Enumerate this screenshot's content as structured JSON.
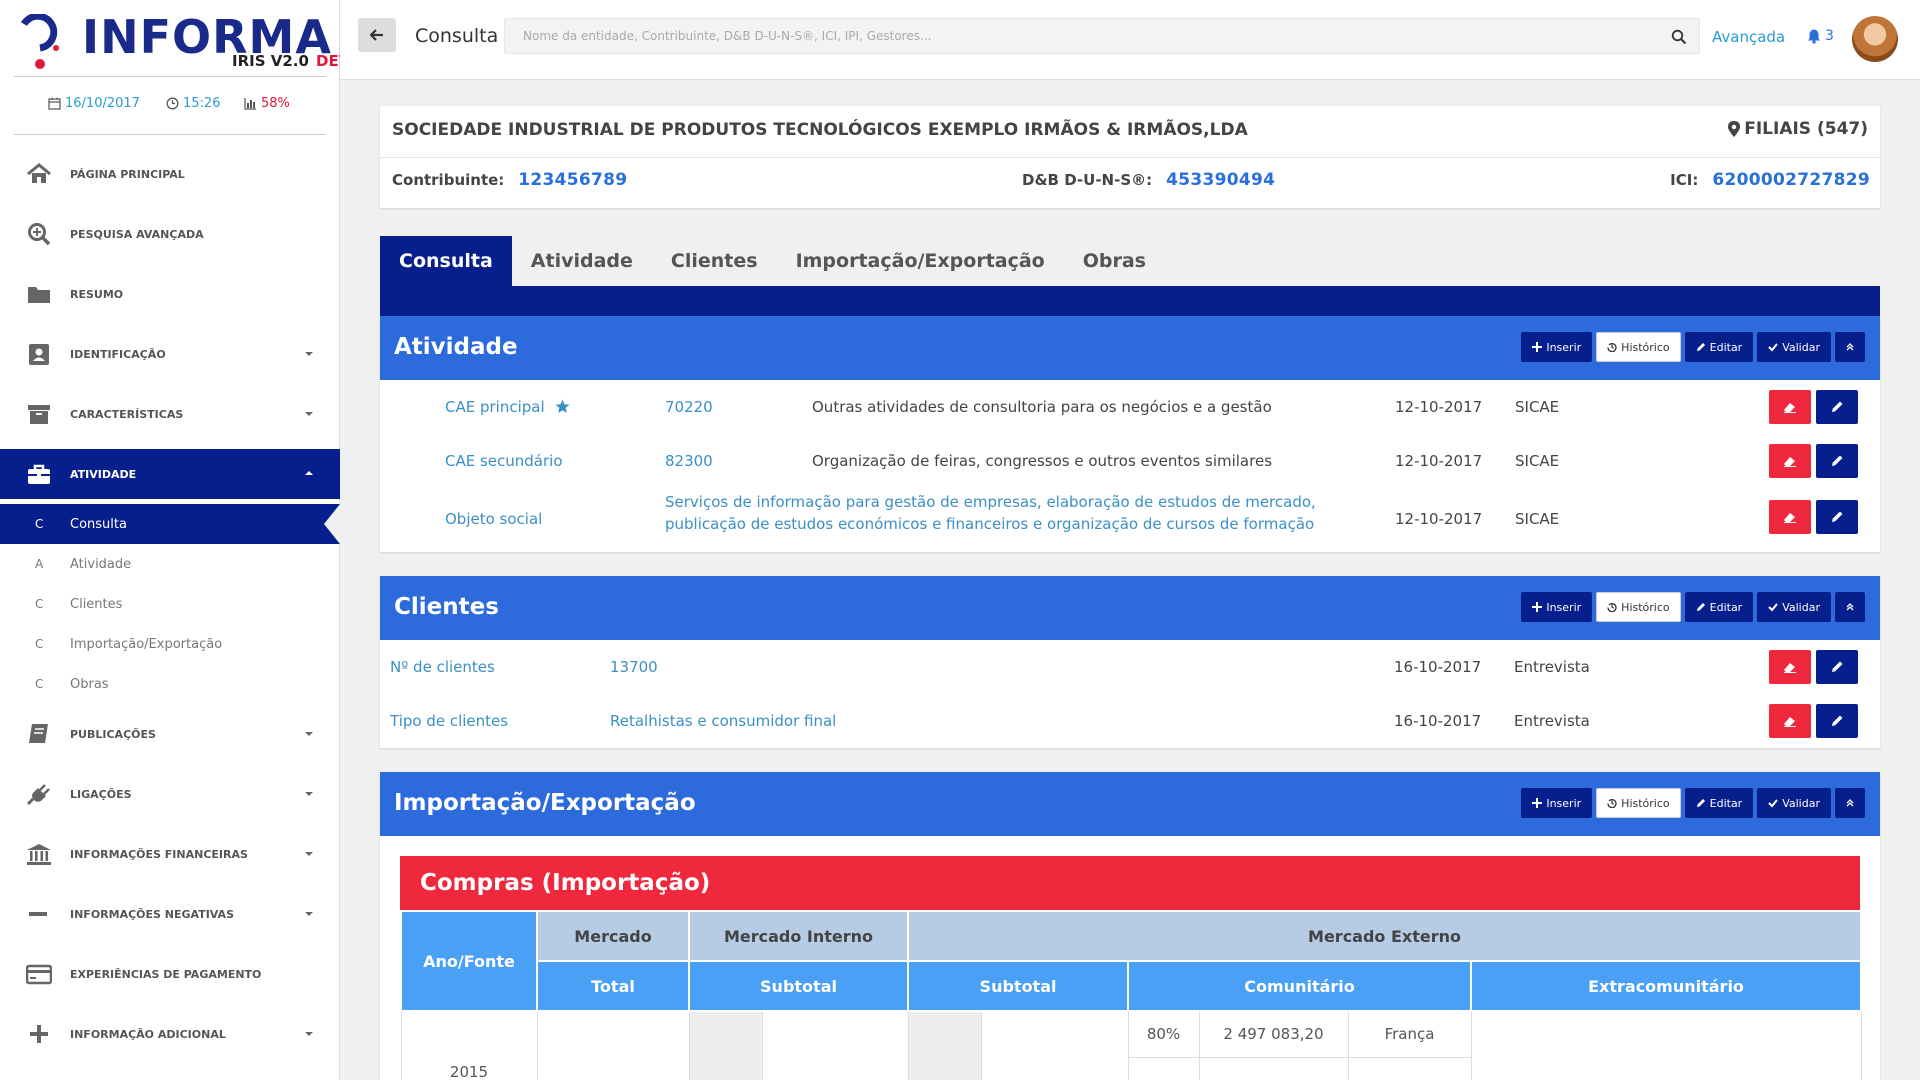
{
  "brand": {
    "name": "INFORMA",
    "version": "IRIS V2.0",
    "env": "DEV"
  },
  "status": {
    "date": "16/10/2017",
    "time": "15:26",
    "percent": "58%"
  },
  "nav": {
    "items": [
      {
        "label": "PÁGINA PRINCIPAL",
        "icon": "home-icon"
      },
      {
        "label": "PESQUISA AVANÇADA",
        "icon": "zoom-icon"
      },
      {
        "label": "RESUMO",
        "icon": "folder-icon"
      },
      {
        "label": "IDENTIFICAÇÃO",
        "icon": "id-card-icon"
      },
      {
        "label": "CARACTERÍSTICAS",
        "icon": "archive-icon"
      },
      {
        "label": "ATIVIDADE",
        "icon": "briefcase-icon"
      },
      {
        "label": "PUBLICAÇÕES",
        "icon": "book-icon"
      },
      {
        "label": "LIGAÇÕES",
        "icon": "plug-icon"
      },
      {
        "label": "INFORMAÇÕES FINANCEIRAS",
        "icon": "bank-icon"
      },
      {
        "label": "INFORMAÇÕES NEGATIVAS",
        "icon": "minus-icon"
      },
      {
        "label": "EXPERIÊNCIAS DE PAGAMENTO",
        "icon": "credit-card-icon"
      },
      {
        "label": "INFORMAÇÃO ADICIONAL",
        "icon": "plus-icon"
      }
    ],
    "sub": [
      {
        "letter": "C",
        "label": "Consulta"
      },
      {
        "letter": "A",
        "label": "Atividade"
      },
      {
        "letter": "C",
        "label": "Clientes"
      },
      {
        "letter": "C",
        "label": "Importação/Exportação"
      },
      {
        "letter": "C",
        "label": "Obras"
      }
    ]
  },
  "topbar": {
    "title": "Consulta",
    "search_placeholder": "Nome da entidade, Contribuinte, D&B D-U-N-S®, ICI, IPI, Gestores...",
    "advanced": "Avançada",
    "notifications": "3"
  },
  "entity": {
    "name": "SOCIEDADE INDUSTRIAL DE PRODUTOS TECNOLÓGICOS EXEMPLO IRMÃOS & IRMÃOS,LDA",
    "filiais": "FILIAIS (547)",
    "contribuinte_label": "Contribuinte:",
    "contribuinte": "123456789",
    "duns_label": "D&B D-U-N-S®:",
    "duns": "453390494",
    "ici_label": "ICI:",
    "ici": "6200002727829"
  },
  "tabs": [
    "Consulta",
    "Atividade",
    "Clientes",
    "Importação/Exportação",
    "Obras"
  ],
  "tools": {
    "insert": "Inserir",
    "history": "Histórico",
    "edit": "Editar",
    "validate": "Validar"
  },
  "atividade": {
    "title": "Atividade",
    "rows": [
      {
        "label": "CAE principal",
        "code": "70220",
        "desc": "Outras atividades de consultoria para os negócios e a gestão",
        "date": "12-10-2017",
        "source": "SICAE"
      },
      {
        "label": "CAE secundário",
        "code": "82300",
        "desc": "Organização de feiras, congressos e outros eventos similares",
        "date": "12-10-2017",
        "source": "SICAE"
      },
      {
        "label": "Objeto social",
        "code": "Serviços de informação para gestão de empresas, elaboração de estudos de mercado, publicação de estudos económicos e financeiros e organização de cursos de formação",
        "date": "12-10-2017",
        "source": "SICAE"
      }
    ]
  },
  "clientes": {
    "title": "Clientes",
    "rows": [
      {
        "label": "Nº de clientes",
        "value": "13700",
        "date": "16-10-2017",
        "source": "Entrevista"
      },
      {
        "label": "Tipo de clientes",
        "value": "Retalhistas e consumidor final",
        "date": "16-10-2017",
        "source": "Entrevista"
      }
    ]
  },
  "impexp": {
    "title": "Importação/Exportação",
    "compras": {
      "title": "Compras (Importação)",
      "h_ano": "Ano/Fonte",
      "h_mercado": "Mercado",
      "h_interno": "Mercado Interno",
      "h_externo": "Mercado Externo",
      "h_total": "Total",
      "h_subtotal": "Subtotal",
      "h_subtotal2": "Subtotal",
      "h_comunitario": "Comunitário",
      "h_extra": "Extracomunitário",
      "row": {
        "year": "2015",
        "pct": "80%",
        "amount": "2 497 083,20",
        "country": "França"
      }
    }
  },
  "colors": {
    "navy": "#071f8c",
    "blue": "#2d6bdc",
    "red": "#f0283e",
    "link": "#3b8fc7",
    "accent": "#2a9bd6"
  }
}
